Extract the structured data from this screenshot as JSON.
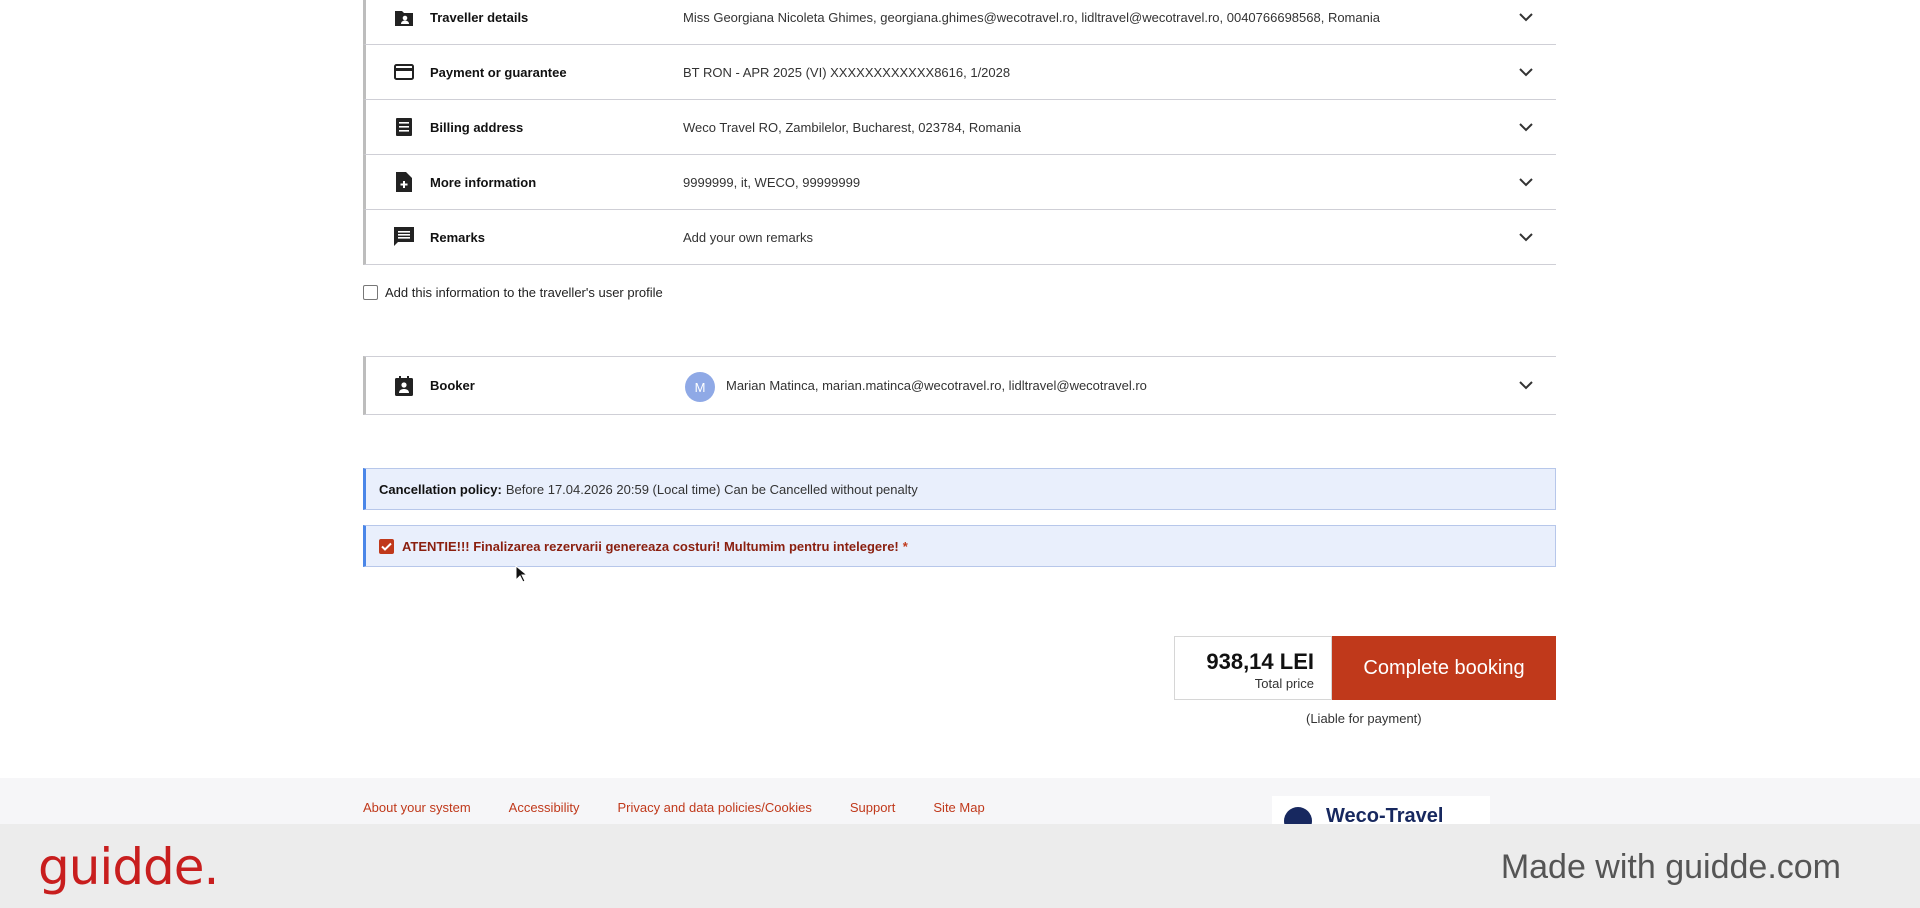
{
  "sections": [
    {
      "title": "Traveller details",
      "value": "Miss Georgiana Nicoleta Ghimes, georgiana.ghimes@wecotravel.ro, lidltravel@wecotravel.ro, 0040766698568, Romania",
      "icon": "person-folder-icon"
    },
    {
      "title": "Payment or guarantee",
      "value": "BT RON - APR 2025 (VI) XXXXXXXXXXXX8616, 1/2028",
      "icon": "credit-card-icon"
    },
    {
      "title": "Billing address",
      "value": "Weco Travel RO, Zambilelor, Bucharest, 023784, Romania",
      "icon": "document-list-icon"
    },
    {
      "title": "More information",
      "value": "9999999, it, WECO, 99999999",
      "icon": "add-document-icon"
    },
    {
      "title": "Remarks",
      "value": "Add your own remarks",
      "icon": "comment-icon"
    }
  ],
  "profile_checkbox": {
    "label": "Add this information to the traveller's user profile",
    "checked": false
  },
  "booker": {
    "title": "Booker",
    "avatar_initial": "M",
    "value": "Marian Matinca, marian.matinca@wecotravel.ro, lidltravel@wecotravel.ro",
    "icon": "contact-card-icon"
  },
  "cancellation": {
    "label": "Cancellation policy:",
    "text": "Before 17.04.2026 20:59 (Local time) Can be Cancelled without penalty"
  },
  "attention": {
    "text": "ATENTIE!!! Finalizarea rezervarii genereaza costuri! Multumim pentru intelegere!",
    "required_mark": "*",
    "checked": true
  },
  "price": {
    "amount": "938,14 LEI",
    "label": "Total price",
    "note": "(Liable for payment)"
  },
  "complete_button": "Complete booking",
  "footer": {
    "links": [
      "About your system",
      "Accessibility",
      "Privacy and data policies/Cookies",
      "Support",
      "Site Map"
    ],
    "logo_text": "Weco-Travel"
  },
  "banner": {
    "brand": "guidde.",
    "made_with": "Made with guidde.com"
  },
  "colors": {
    "accent": "#c0391b",
    "notice_bg": "#e9effc",
    "notice_border": "#4a86e8",
    "avatar": "#8fa9e6"
  }
}
